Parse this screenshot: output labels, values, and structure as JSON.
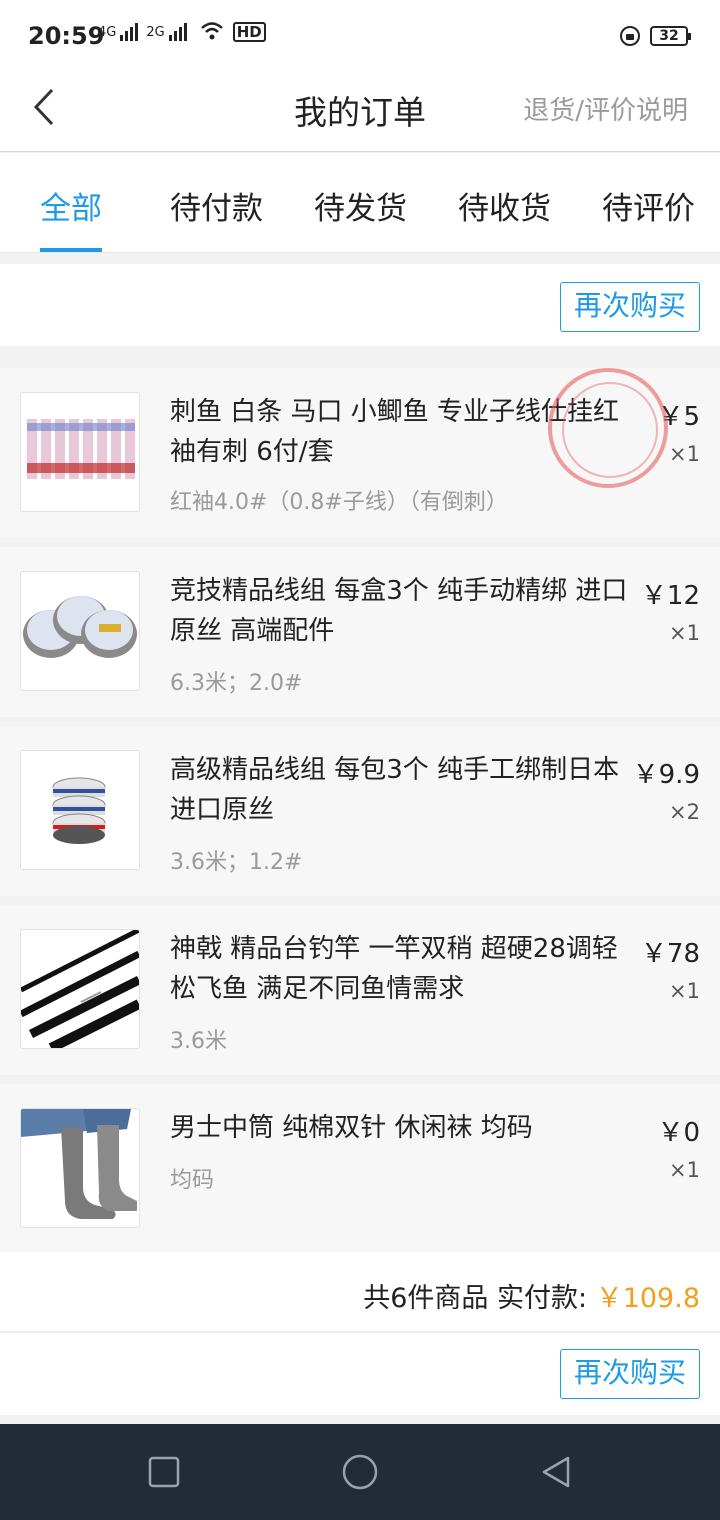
{
  "status_bar": {
    "time": "20:59",
    "sim1": "4G",
    "sim2": "2G",
    "hd": "HD",
    "battery": "32"
  },
  "header": {
    "title": "我的订单",
    "right_link": "退货/评价说明"
  },
  "tabs": [
    {
      "label": "全部",
      "active": true
    },
    {
      "label": "待付款"
    },
    {
      "label": "待发货"
    },
    {
      "label": "待收货"
    },
    {
      "label": "待评价"
    }
  ],
  "buy_again_label": "再次购买",
  "order": {
    "items": [
      {
        "title": "刺鱼 白条 马口 小鲫鱼 专业子线仕挂红袖有刺 6付/套",
        "spec": "红袖4.0#（0.8#子线）（有倒刺）",
        "price": "￥5",
        "qty": "×1",
        "image_icon": "hook-pack-icon"
      },
      {
        "title": "竞技精品线组 每盒3个 纯手动精绑 进口原丝 高端配件",
        "spec": "6.3米；2.0#",
        "price": "￥12",
        "qty": "×1",
        "image_icon": "line-box-icon"
      },
      {
        "title": "高级精品线组 每包3个 纯手工绑制日本进口原丝",
        "spec": "3.6米；1.2#",
        "price": "￥9.9",
        "qty": "×2",
        "image_icon": "line-spool-icon"
      },
      {
        "title": "神戟 精品台钓竿 一竿双稍 超硬28调轻松飞鱼 满足不同鱼情需求",
        "spec": "3.6米",
        "price": "￥78",
        "qty": "×1",
        "image_icon": "fishing-rod-icon"
      },
      {
        "title": "男士中筒 纯棉双针 休闲袜 均码",
        "spec": "均码",
        "price": "￥0",
        "qty": "×1",
        "image_icon": "sock-icon"
      }
    ],
    "summary_prefix": "共6件商品  实付款:",
    "summary_amount": "￥109.8"
  },
  "colors": {
    "accent": "#1e9be4",
    "amount": "#f0a020",
    "muted": "#9a9a9a"
  }
}
